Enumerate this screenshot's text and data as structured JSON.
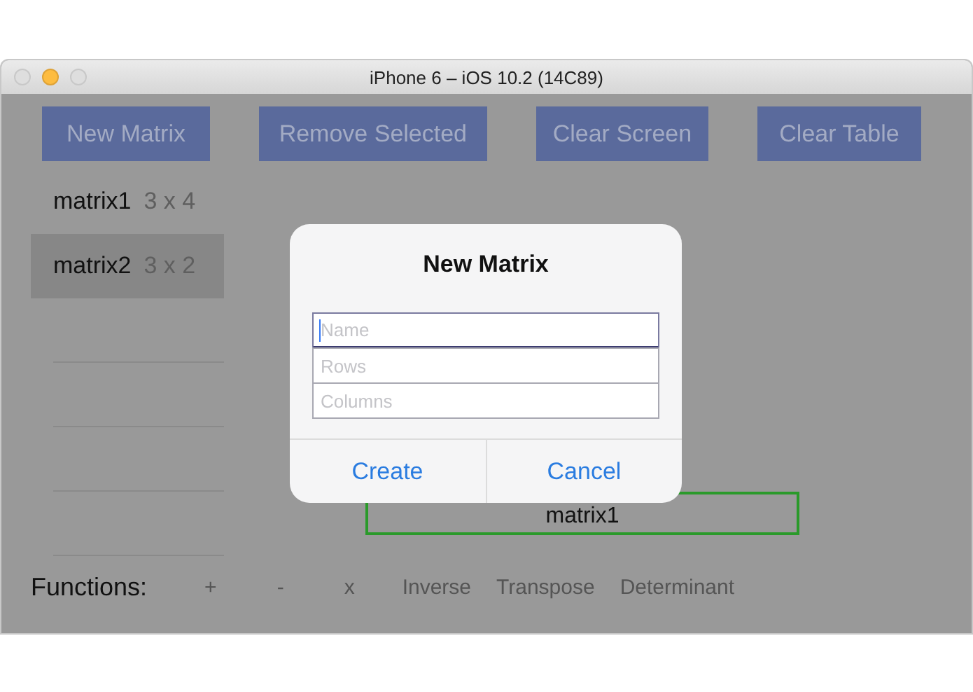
{
  "window": {
    "title": "iPhone 6 – iOS 10.2 (14C89)"
  },
  "toolbar": [
    "New Matrix",
    "Remove Selected",
    "Clear Screen",
    "Clear Table"
  ],
  "matrices": [
    {
      "name": "matrix1",
      "size": "3 x 4",
      "selected": false
    },
    {
      "name": "matrix2",
      "size": "3 x 2",
      "selected": true
    }
  ],
  "result": {
    "label": "matrix1"
  },
  "functions": {
    "label": "Functions:",
    "items": [
      "+",
      "-",
      "x",
      "Inverse",
      "Transpose",
      "Determinant"
    ]
  },
  "dialog": {
    "title": "New Matrix",
    "fields": [
      {
        "placeholder": "Name",
        "focused": true
      },
      {
        "placeholder": "Rows",
        "focused": false
      },
      {
        "placeholder": "Columns",
        "focused": false
      }
    ],
    "buttons": [
      "Create",
      "Cancel"
    ]
  }
}
